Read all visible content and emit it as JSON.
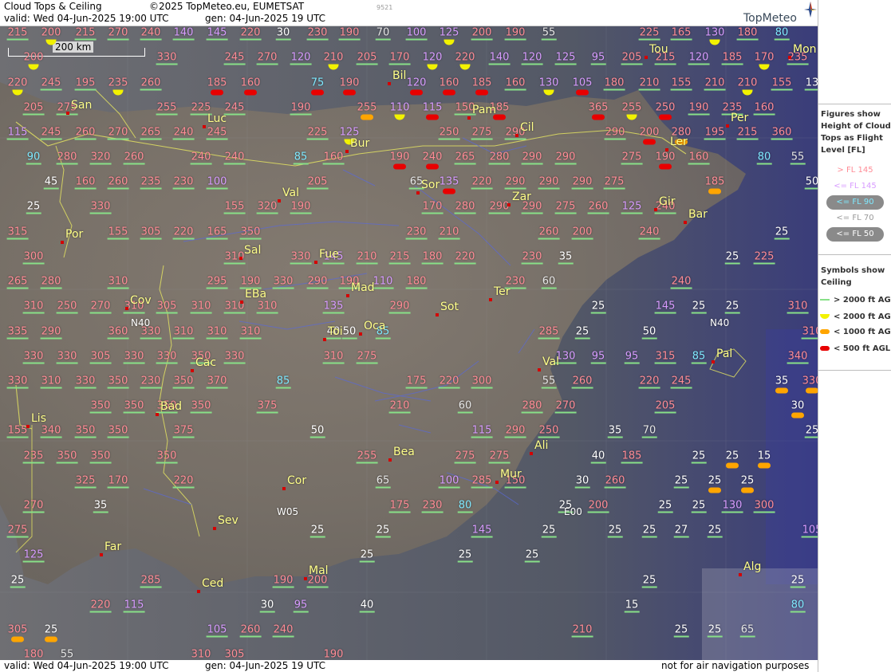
{
  "header": {
    "title": "Cloud Tops & Ceiling",
    "copyright": "©2025 TopMeteo.eu, EUMETSAT",
    "valid": "valid:  Wed  04-Jun-2025  19:00 UTC",
    "generated": "gen: 04-Jun-2025 19 UTC",
    "code": "9521",
    "brand": "TopMeteo"
  },
  "footer": {
    "valid": "valid:  Wed  04-Jun-2025  19:00 UTC",
    "generated": "gen: 04-Jun-2025 19 UTC",
    "disclaimer": "not for air navigation purposes"
  },
  "scale_label": "200 km",
  "legend": {
    "figures_heading": "Figures show Height of Cloud Tops as Flight Level  [FL]",
    "fl_items": [
      {
        "label": "> FL 145",
        "color": "#ff8c96"
      },
      {
        "label": "<= FL 145",
        "color": "#d89cff"
      },
      {
        "label": "<= FL 90",
        "color": "#7fe9ff"
      },
      {
        "label": "<= FL 70",
        "color": "#9a9a9a"
      },
      {
        "label": "<= FL 50",
        "color": "#ffffff"
      }
    ],
    "symbols_heading": "Symbols show Ceiling",
    "ceiling_items": [
      {
        "label": "> 2000 ft AGL",
        "color": "#88e088"
      },
      {
        "label": "< 2000 ft AGL",
        "color": "#f2f200"
      },
      {
        "label": "< 1000 ft AGL",
        "color": "#ffa500"
      },
      {
        "label": "< 500 ft AGL",
        "color": "#e80000"
      }
    ]
  },
  "cities": [
    "Tou",
    "Mon",
    "Bil",
    "San",
    "Pam",
    "Luc",
    "Cil",
    "Per",
    "Bur",
    "Ler",
    "Sor",
    "Val",
    "Zar",
    "Gir",
    "Bar",
    "Por",
    "Sal",
    "Fue",
    "Mad",
    "EBa",
    "Cov",
    "Ter",
    "Sot",
    "Toi",
    "Oca",
    "Pal",
    "Cac",
    "Val",
    "Bad",
    "Lis",
    "Bea",
    "Ali",
    "Cor",
    "Mur",
    "Sev",
    "Far",
    "Ced",
    "Mal",
    "Alg"
  ],
  "routes": [
    "N40",
    "N40",
    "W05",
    "E00"
  ],
  "cloud_tops": [
    "215",
    "200",
    "215",
    "270",
    "240",
    "140",
    "145",
    "220",
    "30",
    "230",
    "190",
    "70",
    "100",
    "125",
    "200",
    "190",
    "55",
    "225",
    "165",
    "130",
    "180",
    "80",
    "200",
    "330",
    "245",
    "270",
    "120",
    "210",
    "205",
    "170",
    "120",
    "220",
    "140",
    "120",
    "125",
    "95",
    "205",
    "215",
    "120",
    "185",
    "170",
    "235",
    "220",
    "245",
    "195",
    "235",
    "260",
    "185",
    "160",
    "75",
    "190",
    "120",
    "160",
    "185",
    "160",
    "130",
    "105",
    "180",
    "210",
    "155",
    "210",
    "210",
    "155",
    "13",
    "205",
    "275",
    "255",
    "225",
    "245",
    "190",
    "255",
    "110",
    "115",
    "150",
    "185",
    "365",
    "255",
    "250",
    "190",
    "235",
    "160",
    "115",
    "245",
    "260",
    "270",
    "265",
    "240",
    "245",
    "225",
    "125",
    "250",
    "275",
    "290",
    "290",
    "200",
    "280",
    "195",
    "215",
    "360",
    "90",
    "280",
    "320",
    "260",
    "240",
    "240",
    "85",
    "160",
    "190",
    "240",
    "265",
    "280",
    "290",
    "290",
    "275",
    "190",
    "160",
    "80",
    "55",
    "45",
    "160",
    "260",
    "235",
    "230",
    "100",
    "205",
    "65",
    "135",
    "220",
    "290",
    "290",
    "290",
    "275",
    "185",
    "50",
    "25",
    "330",
    "155",
    "320",
    "190",
    "170",
    "280",
    "290",
    "290",
    "275",
    "260",
    "125",
    "240",
    "315",
    "155",
    "305",
    "220",
    "165",
    "350",
    "230",
    "210",
    "260",
    "200",
    "240",
    "25",
    "300",
    "310",
    "330",
    "145",
    "210",
    "215",
    "180",
    "220",
    "230",
    "35",
    "25",
    "225",
    "265",
    "280",
    "310",
    "295",
    "190",
    "330",
    "290",
    "190",
    "110",
    "180",
    "230",
    "60",
    "240",
    "310",
    "250",
    "270",
    "310",
    "305",
    "310",
    "310",
    "310",
    "135",
    "290",
    "25",
    "145",
    "25",
    "25",
    "310",
    "335",
    "290",
    "360",
    "330",
    "310",
    "310",
    "310",
    "40",
    "50",
    "85",
    "285",
    "25",
    "50",
    "310",
    "330",
    "330",
    "305",
    "330",
    "330",
    "350",
    "330",
    "310",
    "275",
    "130",
    "95",
    "95",
    "315",
    "85",
    "340",
    "330",
    "310",
    "330",
    "350",
    "230",
    "350",
    "370",
    "85",
    "175",
    "220",
    "300",
    "55",
    "260",
    "220",
    "245",
    "35",
    "330",
    "350",
    "350",
    "350",
    "350",
    "375",
    "210",
    "60",
    "280",
    "270",
    "205",
    "30",
    "155",
    "340",
    "350",
    "350",
    "375",
    "50",
    "115",
    "290",
    "250",
    "35",
    "70",
    "25",
    "235",
    "350",
    "350",
    "350",
    "255",
    "275",
    "275",
    "40",
    "185",
    "25",
    "25",
    "15",
    "325",
    "170",
    "220",
    "65",
    "100",
    "285",
    "150",
    "30",
    "260",
    "25",
    "25",
    "25",
    "270",
    "35",
    "175",
    "230",
    "80",
    "25",
    "200",
    "25",
    "25",
    "130",
    "300",
    "275",
    "25",
    "25",
    "145",
    "25",
    "25",
    "25",
    "27",
    "25",
    "105",
    "125",
    "25",
    "25",
    "25",
    "25",
    "285",
    "190",
    "200",
    "25",
    "25",
    "220",
    "115",
    "30",
    "95",
    "40",
    "15",
    "80",
    "305",
    "25",
    "105",
    "260",
    "240",
    "210",
    "25",
    "25",
    "65",
    "180",
    "55",
    "310",
    "305",
    "190"
  ]
}
